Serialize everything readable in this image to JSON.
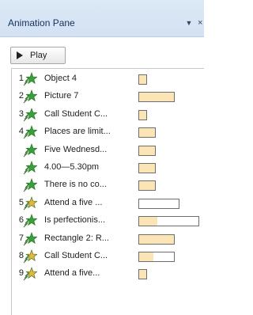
{
  "pane": {
    "title": "Animation Pane",
    "dropdown_glyph": "▼",
    "close_glyph": "×"
  },
  "toolbar": {
    "play_label": "Play"
  },
  "colors": {
    "entrance": "#36a03a",
    "emphasis": "#e8b43a",
    "bar_fill": "#fbe4b5"
  },
  "rows": [
    {
      "num": "1",
      "icon": "entrance-star-icon",
      "label": "Object 4",
      "bar_fill": 1.0
    },
    {
      "num": "2",
      "icon": "entrance-star-icon",
      "label": "Picture 7",
      "bar_fill": 1.0
    },
    {
      "num": "3",
      "icon": "entrance-star-icon",
      "label": "Call  Student C...",
      "bar_fill": 1.0
    },
    {
      "num": "4",
      "icon": "entrance-star-icon",
      "label": "Places are limit...",
      "bar_fill": 1.0
    },
    {
      "num": "",
      "icon": "entrance-star-icon",
      "label": "Five Wednesd...",
      "bar_fill": 1.0
    },
    {
      "num": "",
      "icon": "entrance-star-icon",
      "label": "4.00—5.30pm",
      "bar_fill": 1.0
    },
    {
      "num": "",
      "icon": "entrance-star-icon",
      "label": "There is no co...",
      "bar_fill": 1.0
    },
    {
      "num": "5",
      "icon": "emphasis-star-icon",
      "label": "Attend a five ...",
      "bar_fill": 0.0
    },
    {
      "num": "6",
      "icon": "entrance-star-icon",
      "label": "Is perfectionis...",
      "bar_fill": 0.3
    },
    {
      "num": "7",
      "icon": "entrance-star-icon",
      "label": "Rectangle 2: R...",
      "bar_fill": 1.0
    },
    {
      "num": "8",
      "icon": "emphasis-star-icon",
      "label": "Call  Student C...",
      "bar_fill": 0.4
    },
    {
      "num": "9",
      "icon": "emphasis-star-icon",
      "label": "Attend a five...",
      "bar_fill": 1.0
    }
  ]
}
